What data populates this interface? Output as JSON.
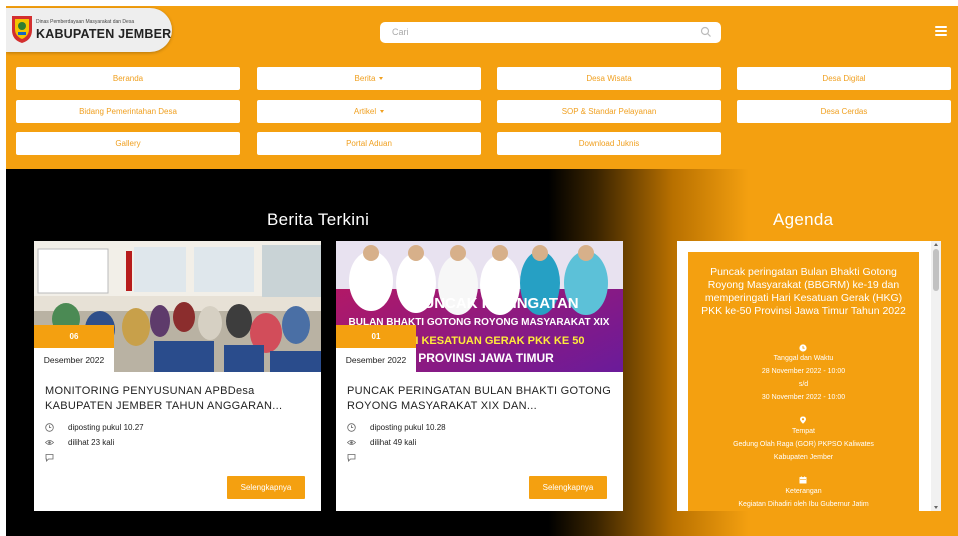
{
  "header": {
    "logo_sub": "Dinas Pemberdayaan Masyarakat dan Desa",
    "logo_main": "KABUPATEN JEMBER",
    "search_placeholder": "Cari",
    "search_icon": "search-icon",
    "menu_icon": "hamburger-icon"
  },
  "nav": {
    "beranda": "Beranda",
    "berita": "Berita",
    "desa_wisata": "Desa Wisata",
    "desa_digital": "Desa Digital",
    "bidang": "Bidang Pemerintahan Desa",
    "artikel": "Artikel",
    "sop": "SOP & Standar Pelayanan",
    "desa_cerdas": "Desa Cerdas",
    "gallery": "Gallery",
    "portal": "Portal Aduan",
    "download": "Download Juknis"
  },
  "berita": {
    "title": "Berita Terkini",
    "cards": [
      {
        "day": "06",
        "month": "Desember 2022",
        "title": "MONITORING PENYUSUNAN APBDesa KABUPATEN JEMBER TAHUN ANGGARAN...",
        "posted": "diposting pukul 10.27",
        "views": "dilihat 23 kali",
        "button": "Selengkapnya"
      },
      {
        "day": "01",
        "month": "Desember 2022",
        "title": "PUNCAK PERINGATAN BULAN BHAKTI GOTONG ROYONG MASYARAKAT XIX DAN...",
        "posted": "diposting pukul 10.28",
        "views": "dilihat 49 kali",
        "button": "Selengkapnya",
        "banner_lines": [
          "PUNCAK PERINGATAN",
          "BULAN BHAKTI GOTONG ROYONG MASYARAKAT XIX",
          "HARI KESATUAN GERAK PKK KE 50",
          "PROVINSI JAWA TIMUR"
        ]
      }
    ]
  },
  "agenda": {
    "title": "Agenda",
    "event_title": "Puncak peringatan Bulan Bhakti Gotong Royong Masyarakat (BBGRM) ke-19 dan memperingati Hari Kesatuan Gerak (HKG) PKK ke-50 Provinsi Jawa Timur Tahun 2022",
    "time_label": "Tanggal dan Waktu",
    "time_start": "28 November 2022 - 10:00",
    "time_sep": "s/d",
    "time_end": "30 November 2022 - 10:00",
    "place_label": "Tempat",
    "place_1": "Gedung Olah Raga (GOR) PKPSO Kaliwates",
    "place_2": "Kabupaten Jember",
    "note_label": "Keterangan",
    "note_1": "Kegiatan Dihadiri oleh Ibu Gubernur Jatim"
  },
  "colors": {
    "accent": "#f4a010",
    "dark": "#000000"
  }
}
